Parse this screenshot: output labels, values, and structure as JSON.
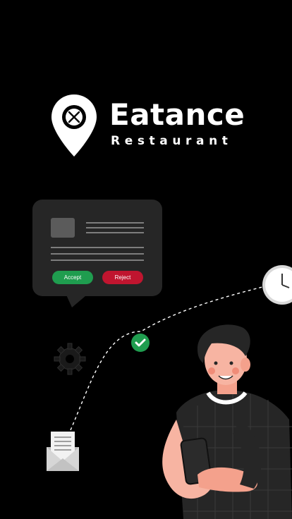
{
  "brand": {
    "title": "Eatance",
    "subtitle": "Restaurant"
  },
  "order_card": {
    "accept_label": "Accept",
    "reject_label": "Reject"
  },
  "colors": {
    "background": "#000000",
    "card": "#262626",
    "accept": "#1f9d4f",
    "reject": "#c0152f",
    "text": "#ffffff"
  },
  "icons": [
    "location-pin-icon",
    "fork-knife-icon",
    "check-icon",
    "gear-icon",
    "clock-icon",
    "mail-icon"
  ]
}
